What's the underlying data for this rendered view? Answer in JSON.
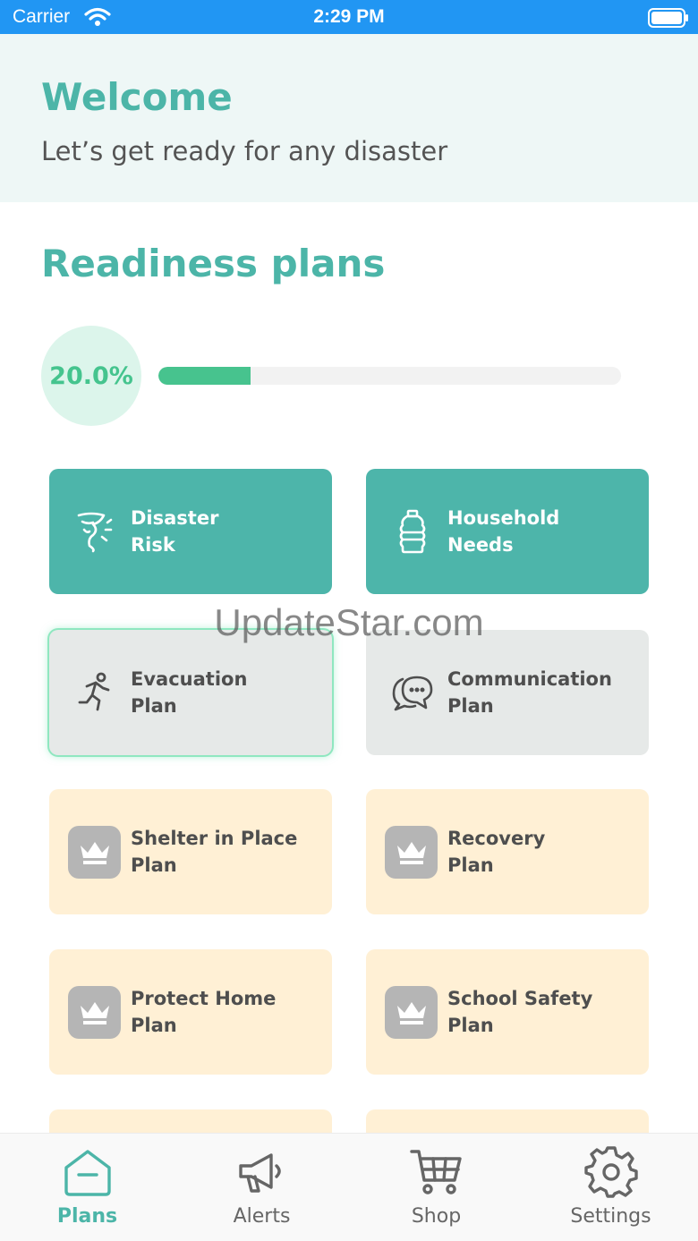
{
  "status_bar": {
    "carrier": "Carrier",
    "time": "2:29 PM"
  },
  "header": {
    "title": "Welcome",
    "subtitle": "Let’s get ready for any disaster"
  },
  "readiness": {
    "title": "Readiness plans",
    "progress_text": "20.0%",
    "progress_fraction": 0.2
  },
  "cards": [
    {
      "line1": "Disaster",
      "line2": "Risk",
      "style": "unlocked",
      "icon": "tornado-icon"
    },
    {
      "line1": "Household",
      "line2": "Needs",
      "style": "unlocked",
      "icon": "water-bottle-icon"
    },
    {
      "line1": "Evacuation",
      "line2": "Plan",
      "style": "available",
      "icon": "running-person-icon"
    },
    {
      "line1": "Communication",
      "line2": "Plan",
      "style": "available",
      "icon": "chat-bubbles-icon"
    },
    {
      "line1": "Shelter in Place",
      "line2": "Plan",
      "style": "premium",
      "icon": "crown-icon"
    },
    {
      "line1": "Recovery",
      "line2": "Plan",
      "style": "premium",
      "icon": "crown-icon"
    },
    {
      "line1": "Protect Home",
      "line2": "Plan",
      "style": "premium",
      "icon": "crown-icon"
    },
    {
      "line1": "School Safety",
      "line2": "Plan",
      "style": "premium",
      "icon": "crown-icon"
    }
  ],
  "tabs": [
    {
      "label": "Plans",
      "icon": "home-icon",
      "active": true
    },
    {
      "label": "Alerts",
      "icon": "megaphone-icon",
      "active": false
    },
    {
      "label": "Shop",
      "icon": "cart-icon",
      "active": false
    },
    {
      "label": "Settings",
      "icon": "gear-icon",
      "active": false
    }
  ],
  "colors": {
    "status_bar": "#2196f3",
    "accent": "#4cb5a8",
    "progress": "#47c38e",
    "premium_card": "#fff0d5"
  },
  "watermark": "UpdateStar.com"
}
